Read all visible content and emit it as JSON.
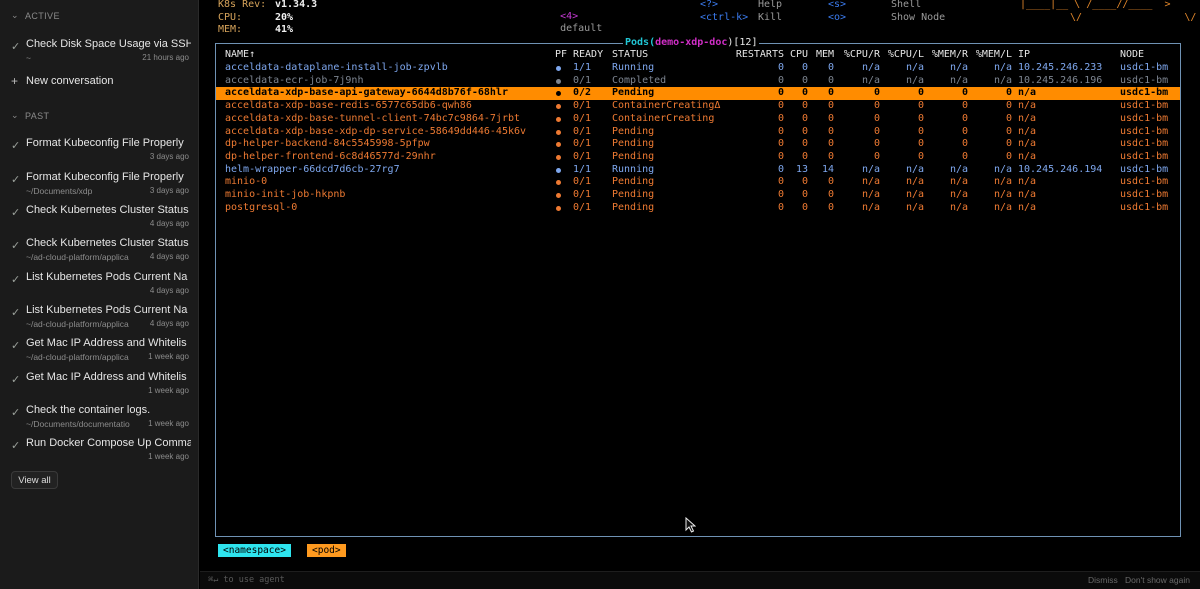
{
  "sidebar": {
    "active_label": "ACTIVE",
    "past_label": "PAST",
    "active_items": [
      {
        "title": "Check Disk Space Usage via SSH",
        "path": "~",
        "time": "21 hours ago"
      }
    ],
    "new_conversation": "New conversation",
    "past_items": [
      {
        "title": "Format Kubeconfig File Properly",
        "path": "",
        "time": "3 days ago"
      },
      {
        "title": "Format Kubeconfig File Properly",
        "path": "~/Documents/xdp",
        "time": "3 days ago"
      },
      {
        "title": "Check Kubernetes Cluster Status",
        "path": "",
        "time": "4 days ago"
      },
      {
        "title": "Check Kubernetes Cluster Status",
        "path": "~/ad-cloud-platform/applica",
        "time": "4 days ago"
      },
      {
        "title": "List Kubernetes Pods Current Na",
        "path": "",
        "time": "4 days ago"
      },
      {
        "title": "List Kubernetes Pods Current Na",
        "path": "~/ad-cloud-platform/applica",
        "time": "4 days ago"
      },
      {
        "title": "Get Mac IP Address and Whitelis",
        "path": "~/ad-cloud-platform/applica",
        "time": "1 week ago"
      },
      {
        "title": "Get Mac IP Address and Whitelis",
        "path": "",
        "time": "1 week ago"
      },
      {
        "title": "Check the container logs.",
        "path": "~/Documents/documentatio",
        "time": "1 week ago"
      },
      {
        "title": "Run Docker Compose Up Comma",
        "path": "",
        "time": "1 week ago"
      }
    ],
    "view_all": "View all"
  },
  "header": {
    "k8s_rev_label": "K8s Rev:",
    "k8s_rev_value": "v1.34.3",
    "cpu_label": "CPU:",
    "cpu_value": "20%",
    "mem_label": "MEM:",
    "mem_value": "41%",
    "ns_key": "<4>",
    "ns_value": "default",
    "shortcuts": [
      {
        "key": "<?>",
        "label": "Help"
      },
      {
        "key": "<ctrl-k>",
        "label": "Kill"
      },
      {
        "key": "<s>",
        "label": "Shell"
      },
      {
        "key": "<o>",
        "label": "Show Node"
      }
    ],
    "logo_line1": "|____|__ \\ /____//____  >",
    "logo_line2": "\\/                 \\/"
  },
  "pods": {
    "title_prefix": "Pods(",
    "namespace": "demo-xdp-doc",
    "title_suffix": ")[12]",
    "columns": [
      "NAME↑",
      "PF",
      "READY",
      "STATUS",
      "RESTARTS",
      "CPU",
      "MEM",
      "%CPU/R",
      "%CPU/L",
      "%MEM/R",
      "%MEM/L",
      "IP",
      "NODE"
    ],
    "rows": [
      {
        "name": "acceldata-dataplane-install-job-zpvlb",
        "ready": "1/1",
        "status": "Running",
        "restarts": "0",
        "cpu": "0",
        "mem": "0",
        "cpur": "n/a",
        "cpul": "n/a",
        "memr": "n/a",
        "meml": "n/a",
        "ip": "10.245.246.233",
        "node": "usdc1-bm",
        "state": "running"
      },
      {
        "name": "acceldata-ecr-job-7j9nh",
        "ready": "0/1",
        "status": "Completed",
        "restarts": "0",
        "cpu": "0",
        "mem": "0",
        "cpur": "n/a",
        "cpul": "n/a",
        "memr": "n/a",
        "meml": "n/a",
        "ip": "10.245.246.196",
        "node": "usdc1-bm",
        "state": "completed"
      },
      {
        "name": "acceldata-xdp-base-api-gateway-6644d8b76f-68hlr",
        "ready": "0/2",
        "status": "Pending",
        "restarts": "0",
        "cpu": "0",
        "mem": "0",
        "cpur": "0",
        "cpul": "0",
        "memr": "0",
        "meml": "0",
        "ip": "n/a",
        "node": "usdc1-bm",
        "state": "selected"
      },
      {
        "name": "acceldata-xdp-base-redis-6577c65db6-qwh86",
        "ready": "0/1",
        "status": "ContainerCreatingΔ",
        "restarts": "0",
        "cpu": "0",
        "mem": "0",
        "cpur": "0",
        "cpul": "0",
        "memr": "0",
        "meml": "0",
        "ip": "n/a",
        "node": "usdc1-bm",
        "state": "pending"
      },
      {
        "name": "acceldata-xdp-base-tunnel-client-74bc7c9864-7jrbt",
        "ready": "0/1",
        "status": "ContainerCreating",
        "restarts": "0",
        "cpu": "0",
        "mem": "0",
        "cpur": "0",
        "cpul": "0",
        "memr": "0",
        "meml": "0",
        "ip": "n/a",
        "node": "usdc1-bm",
        "state": "pending"
      },
      {
        "name": "acceldata-xdp-base-xdp-dp-service-58649dd446-45k6v",
        "ready": "0/1",
        "status": "Pending",
        "restarts": "0",
        "cpu": "0",
        "mem": "0",
        "cpur": "0",
        "cpul": "0",
        "memr": "0",
        "meml": "0",
        "ip": "n/a",
        "node": "usdc1-bm",
        "state": "pending"
      },
      {
        "name": "dp-helper-backend-84c5545998-5pfpw",
        "ready": "0/1",
        "status": "Pending",
        "restarts": "0",
        "cpu": "0",
        "mem": "0",
        "cpur": "0",
        "cpul": "0",
        "memr": "0",
        "meml": "0",
        "ip": "n/a",
        "node": "usdc1-bm",
        "state": "pending"
      },
      {
        "name": "dp-helper-frontend-6c8d46577d-29nhr",
        "ready": "0/1",
        "status": "Pending",
        "restarts": "0",
        "cpu": "0",
        "mem": "0",
        "cpur": "0",
        "cpul": "0",
        "memr": "0",
        "meml": "0",
        "ip": "n/a",
        "node": "usdc1-bm",
        "state": "pending"
      },
      {
        "name": "helm-wrapper-66dcd7d6cb-27rg7",
        "ready": "1/1",
        "status": "Running",
        "restarts": "0",
        "cpu": "13",
        "mem": "14",
        "cpur": "n/a",
        "cpul": "n/a",
        "memr": "n/a",
        "meml": "n/a",
        "ip": "10.245.246.194",
        "node": "usdc1-bm",
        "state": "running"
      },
      {
        "name": "minio-0",
        "ready": "0/1",
        "status": "Pending",
        "restarts": "0",
        "cpu": "0",
        "mem": "0",
        "cpur": "n/a",
        "cpul": "n/a",
        "memr": "n/a",
        "meml": "n/a",
        "ip": "n/a",
        "node": "usdc1-bm",
        "state": "pending"
      },
      {
        "name": "minio-init-job-hkpnb",
        "ready": "0/1",
        "status": "Pending",
        "restarts": "0",
        "cpu": "0",
        "mem": "0",
        "cpur": "n/a",
        "cpul": "n/a",
        "memr": "n/a",
        "meml": "n/a",
        "ip": "n/a",
        "node": "usdc1-bm",
        "state": "pending"
      },
      {
        "name": "postgresql-0",
        "ready": "0/1",
        "status": "Pending",
        "restarts": "0",
        "cpu": "0",
        "mem": "0",
        "cpur": "n/a",
        "cpul": "n/a",
        "memr": "n/a",
        "meml": "n/a",
        "ip": "n/a",
        "node": "usdc1-bm",
        "state": "pending"
      }
    ]
  },
  "breadcrumbs": [
    "<namespace>",
    "<pod>"
  ],
  "bottom_bar": {
    "agent_hint": "⌘↵ to use agent",
    "dismiss": "Dismiss",
    "dont_show": "Don't show again"
  },
  "colors": {
    "running": "#7ea7ee",
    "completed": "#7d8591",
    "pending": "#ee7a32",
    "selected_bg": "#ff8c00",
    "border": "#6f92b4"
  }
}
